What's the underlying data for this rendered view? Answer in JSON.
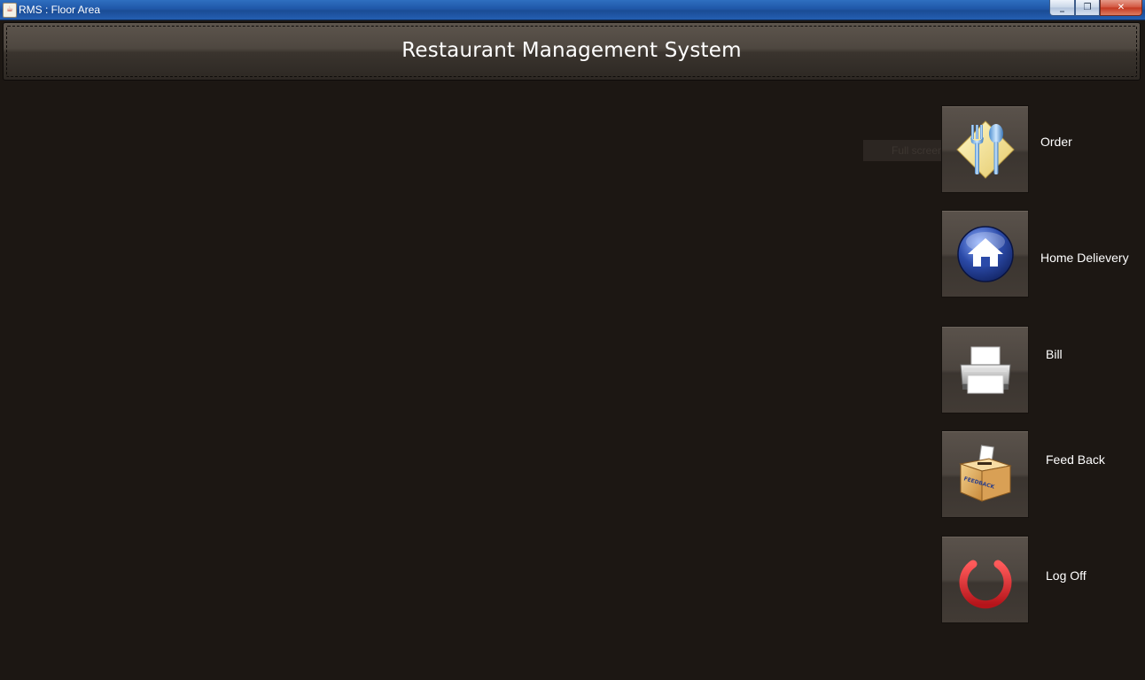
{
  "window": {
    "title": "RMS : Floor Area",
    "icon": "java-cup-icon",
    "controls": {
      "minimize": "_",
      "maximize": "❐",
      "close": "✕"
    }
  },
  "header": {
    "title": "Restaurant Management System"
  },
  "tooltip": {
    "text": "Full screen"
  },
  "nav": {
    "order": {
      "label": "Order",
      "icon": "cutlery-icon"
    },
    "home_delivery": {
      "label": "Home Delievery",
      "icon": "home-icon"
    },
    "bill": {
      "label": "Bill",
      "icon": "printer-icon"
    },
    "feedback": {
      "label": "Feed Back",
      "icon": "feedback-box-icon",
      "icon_text": "FEEDBACK"
    },
    "logoff": {
      "label": "Log Off",
      "icon": "power-icon"
    }
  },
  "colors": {
    "background": "#1c1713",
    "header": "#4e4740",
    "button": "#4c453f",
    "power_red": "#e0262a",
    "home_blue": "#1f3d8f",
    "titlebar_blue": "#1f57a8"
  }
}
